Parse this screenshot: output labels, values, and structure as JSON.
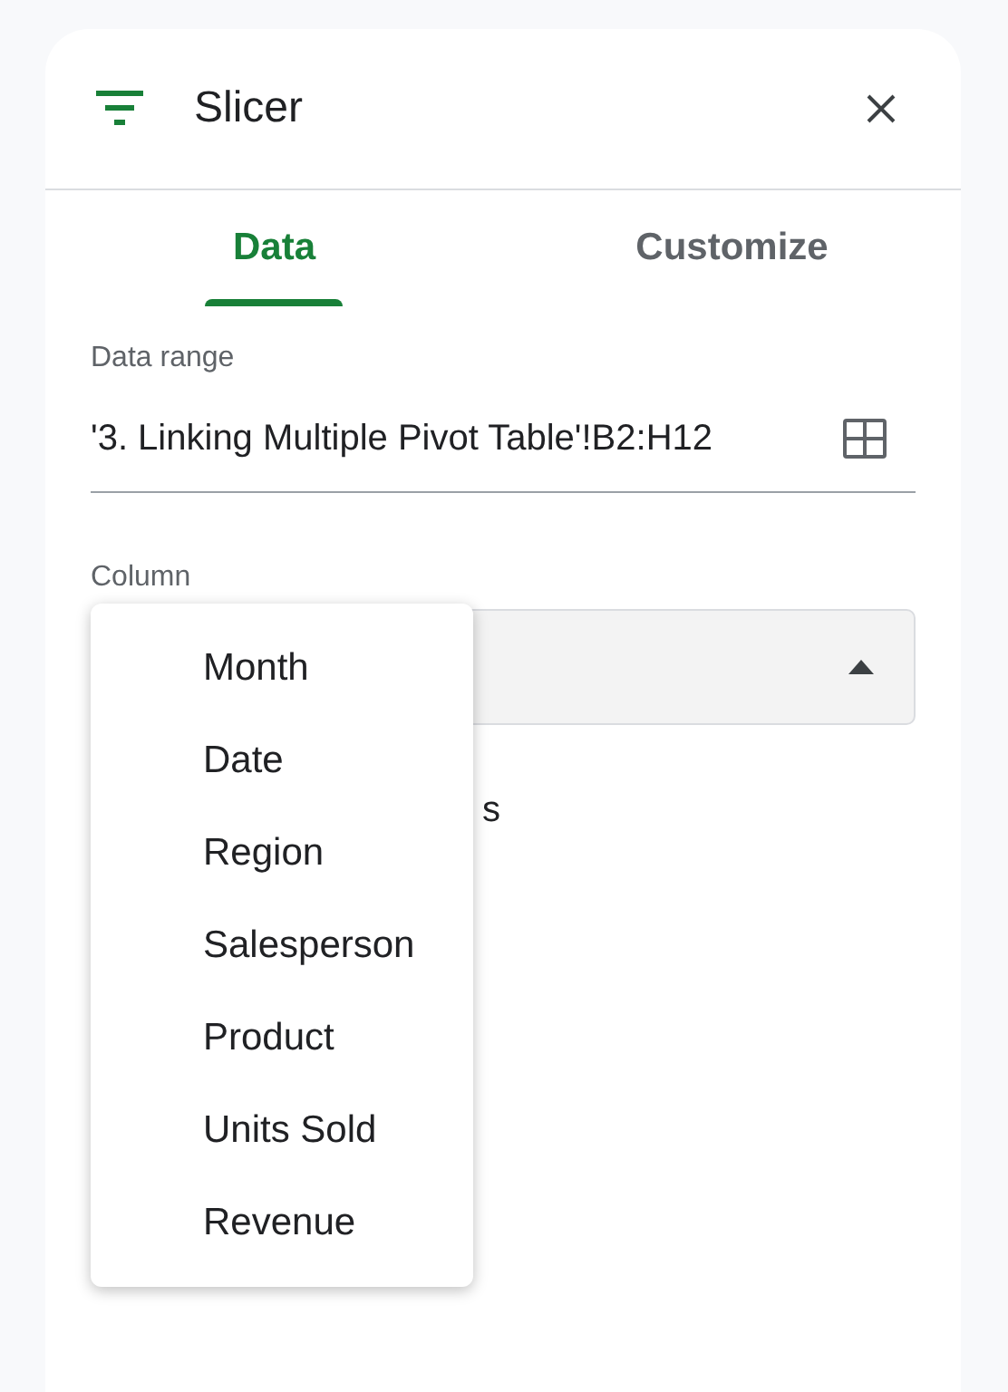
{
  "panel": {
    "title": "Slicer"
  },
  "tabs": [
    {
      "label": "Data",
      "selected": true
    },
    {
      "label": "Customize",
      "selected": false
    }
  ],
  "data_range": {
    "label": "Data range",
    "value": "'3. Linking Multiple Pivot Table'!B2:H12"
  },
  "column": {
    "label": "Column",
    "expanded": true
  },
  "partial_text": "s",
  "column_menu": [
    "Month",
    "Date",
    "Region",
    "Salesperson",
    "Product",
    "Units Sold",
    "Revenue"
  ]
}
